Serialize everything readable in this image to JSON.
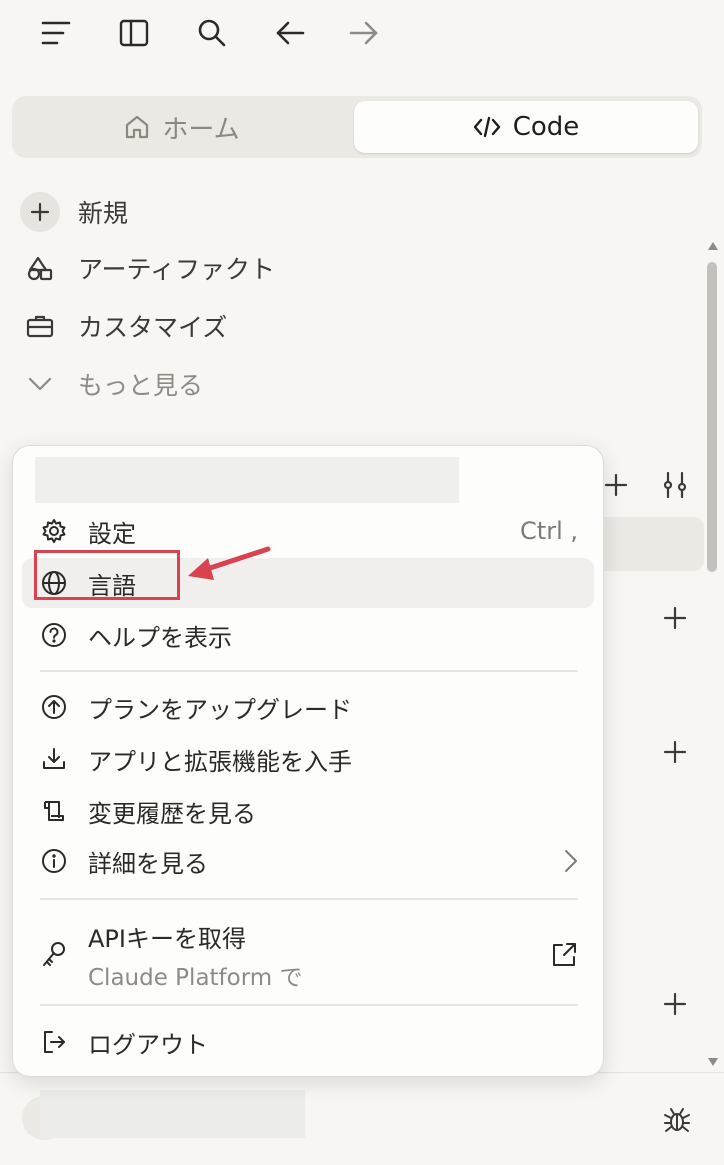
{
  "toolbar": {
    "icons": [
      "menu-icon",
      "sidebar-toggle-icon",
      "search-icon",
      "back-arrow-icon",
      "forward-arrow-icon"
    ]
  },
  "segmented": {
    "home_label": "ホーム",
    "code_label": "Code"
  },
  "nav": {
    "new_label": "新規",
    "artifacts_label": "アーティファクト",
    "customize_label": "カスタマイズ",
    "more_label": "もっと見る"
  },
  "menu": {
    "email": "",
    "settings": {
      "label": "設定",
      "shortcut": "Ctrl ,"
    },
    "language": {
      "label": "言語"
    },
    "help": {
      "label": "ヘルプを表示"
    },
    "upgrade": {
      "label": "プランをアップグレード"
    },
    "apps": {
      "label": "アプリと拡張機能を入手"
    },
    "changelog": {
      "label": "変更履歴を見る"
    },
    "details": {
      "label": "詳細を見る"
    },
    "api": {
      "label": "APIキーを取得",
      "sublabel": "Claude Platform で"
    },
    "logout": {
      "label": "ログアウト"
    }
  },
  "footer": {
    "username": ""
  },
  "colors": {
    "background": "#f7f6f2",
    "menu_bg": "#fdfdfc",
    "annotation_red": "#d9424f"
  }
}
